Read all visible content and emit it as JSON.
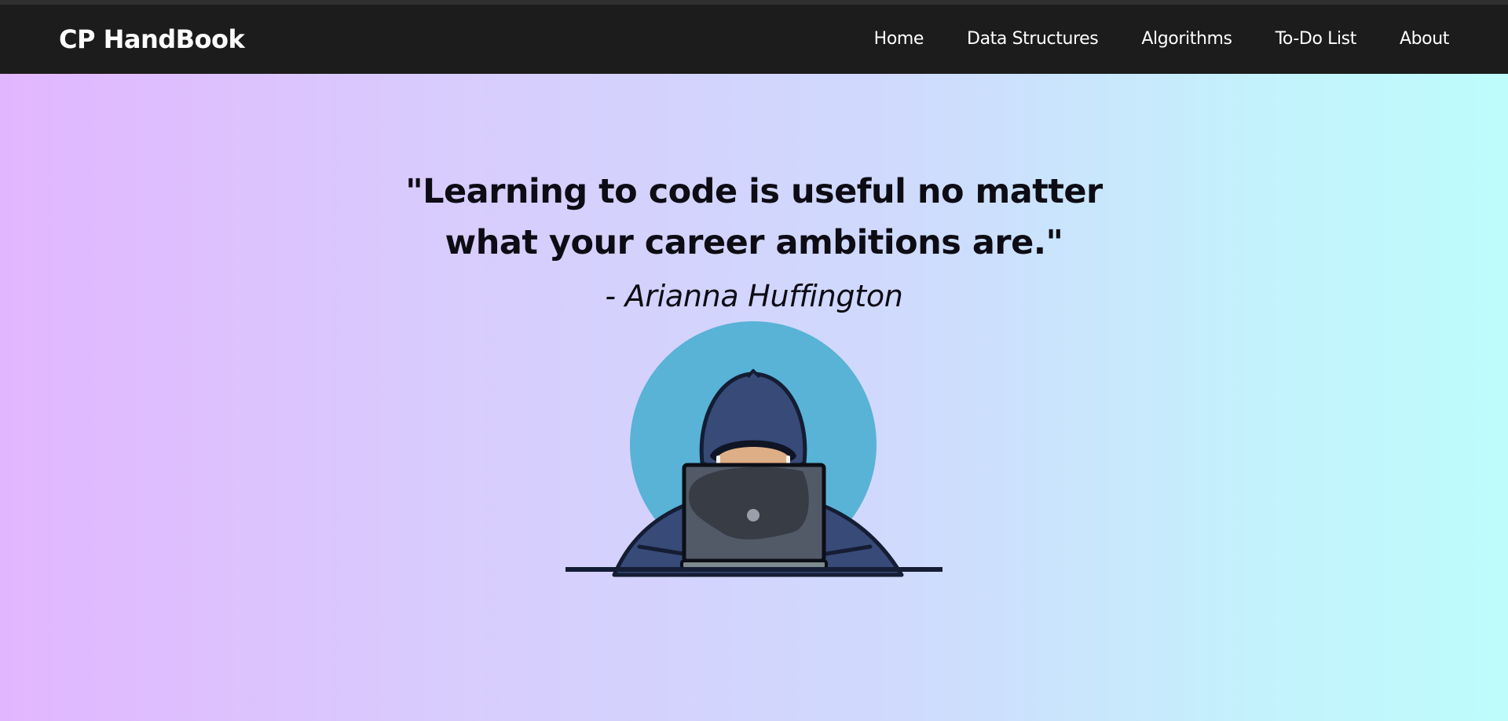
{
  "navbar": {
    "brand": "CP HandBook",
    "links": [
      {
        "label": "Home"
      },
      {
        "label": "Data Structures"
      },
      {
        "label": "Algorithms"
      },
      {
        "label": "To-Do List"
      },
      {
        "label": "About"
      }
    ]
  },
  "hero": {
    "quote": "\"Learning to code is useful no matter what your career ambitions are.\"",
    "author": "- Arianna Huffington",
    "illustration_icon": "hooded-coder-laptop-illustration"
  },
  "colors": {
    "navbar_bg": "#1c1c1c",
    "gradient_left": "#e2b6fe",
    "gradient_right": "#bdfcfb",
    "text": "#0d0c14",
    "illustration_circle": "#58b3d6",
    "hoodie": "#374a78",
    "laptop": "#525a68"
  }
}
